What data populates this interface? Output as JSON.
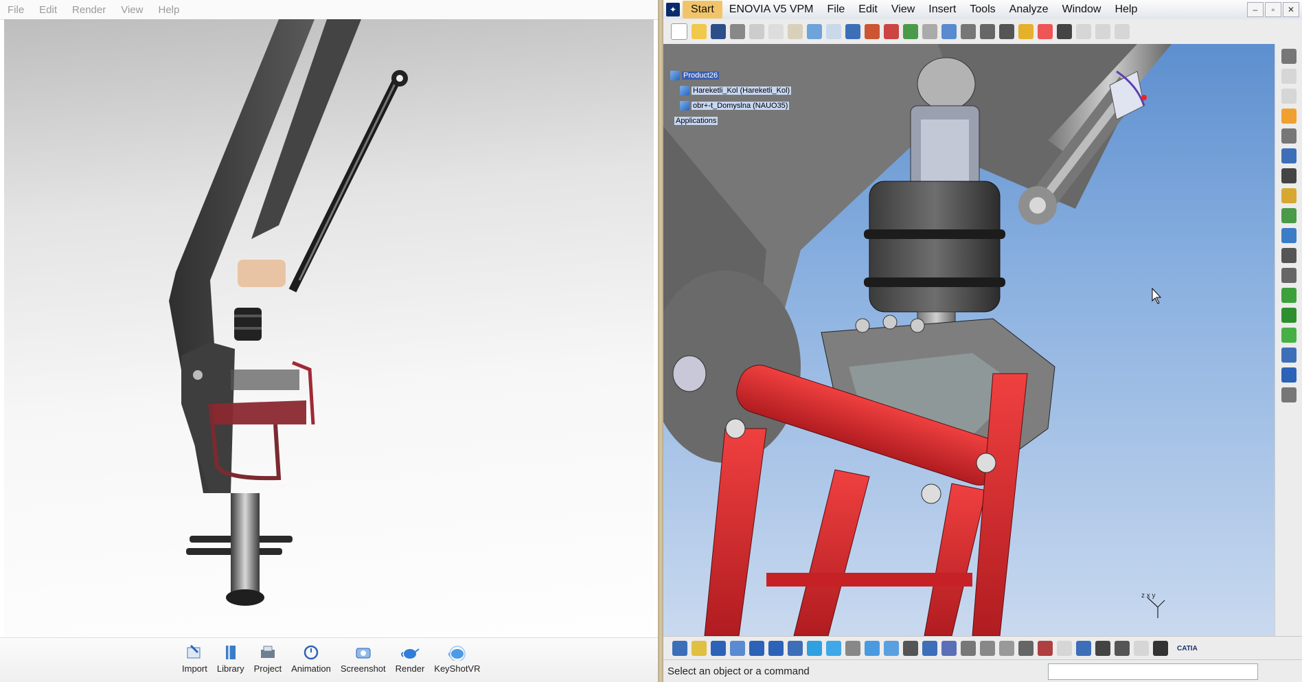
{
  "keyshot": {
    "menu": [
      "File",
      "Edit",
      "Render",
      "View",
      "Help"
    ],
    "toolbar": [
      {
        "label": "Import",
        "icon": "import-icon"
      },
      {
        "label": "Library",
        "icon": "library-icon"
      },
      {
        "label": "Project",
        "icon": "project-icon"
      },
      {
        "label": "Animation",
        "icon": "animation-icon"
      },
      {
        "label": "Screenshot",
        "icon": "screenshot-icon"
      },
      {
        "label": "Render",
        "icon": "render-teapot-icon"
      },
      {
        "label": "KeyShotVR",
        "icon": "keyshotvr-teapot-icon"
      }
    ]
  },
  "catia": {
    "menu": [
      "Start",
      "ENOVIA V5 VPM",
      "File",
      "Edit",
      "View",
      "Insert",
      "Tools",
      "Analyze",
      "Window",
      "Help"
    ],
    "tree": {
      "root": "Product26",
      "children": [
        "Hareketli_Kol (Hareketli_Kol)",
        "obr+-t_Domyslna (NAUO35)"
      ],
      "applications": "Applications"
    },
    "status_message": "Select an object or a command",
    "command_input": "",
    "brand": "CATIA",
    "compass_axes": "z x y",
    "colors": {
      "part_red": "#d8262a",
      "part_gray": "#7d7d7d",
      "background_top": "#5d8fcf",
      "background_bottom": "#c9d9ef",
      "start_button": "#f2c46a"
    }
  }
}
